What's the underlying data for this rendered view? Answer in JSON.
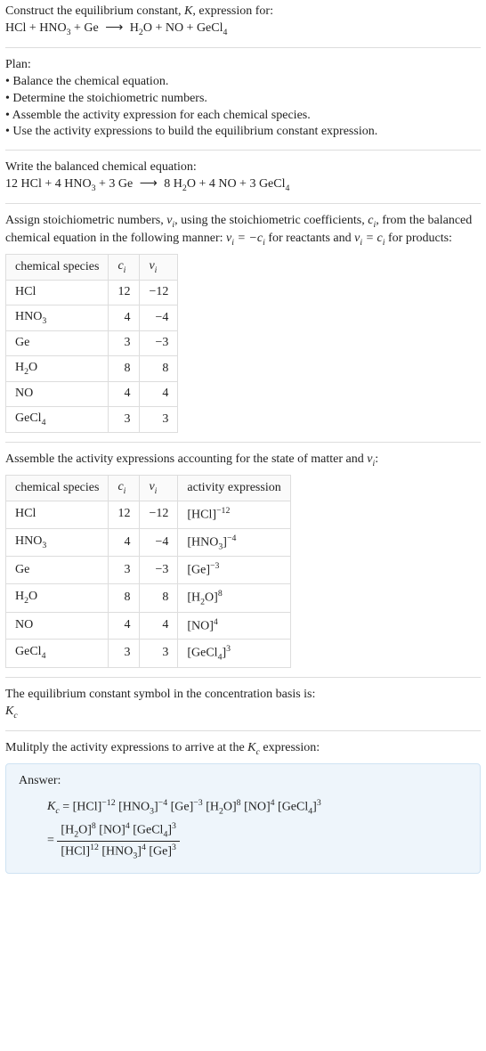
{
  "intro": {
    "line1_a": "Construct the equilibrium constant, ",
    "K": "K",
    "line1_b": ", expression for:",
    "eq_unbalanced_lhs": "HCl + HNO",
    "eq_unbalanced_rhs": " + Ge ",
    "arrow": "⟶",
    "eq_unbalanced_prod": " H₂O + NO + GeCl₄"
  },
  "plan": {
    "header": "Plan:",
    "b1": "• Balance the chemical equation.",
    "b2": "• Determine the stoichiometric numbers.",
    "b3": "• Assemble the activity expression for each chemical species.",
    "b4": "• Use the activity expressions to build the equilibrium constant expression."
  },
  "balanced": {
    "header": "Write the balanced chemical equation:",
    "eq": "12 HCl + 4 HNO₃ + 3 Ge ⟶ 8 H₂O + 4 NO + 3 GeCl₄"
  },
  "stoich_text": {
    "a": "Assign stoichiometric numbers, ",
    "nu": "ν",
    "i": "i",
    "b": ", using the stoichiometric coefficients, ",
    "c": "c",
    "d": ", from the balanced chemical equation in the following manner: ",
    "rel1": "νᵢ = −cᵢ",
    "e": " for reactants and ",
    "rel2": "νᵢ = cᵢ",
    "f": " for products:"
  },
  "table1": {
    "h1": "chemical species",
    "h2": "cᵢ",
    "h3": "νᵢ",
    "rows": [
      {
        "sp": "HCl",
        "ci": "12",
        "vi": "−12"
      },
      {
        "sp": "HNO₃",
        "ci": "4",
        "vi": "−4"
      },
      {
        "sp": "Ge",
        "ci": "3",
        "vi": "−3"
      },
      {
        "sp": "H₂O",
        "ci": "8",
        "vi": "8"
      },
      {
        "sp": "NO",
        "ci": "4",
        "vi": "4"
      },
      {
        "sp": "GeCl₄",
        "ci": "3",
        "vi": "3"
      }
    ]
  },
  "activity_text": "Assemble the activity expressions accounting for the state of matter and νᵢ:",
  "table2": {
    "h1": "chemical species",
    "h2": "cᵢ",
    "h3": "νᵢ",
    "h4": "activity expression",
    "rows": [
      {
        "sp": "HCl",
        "ci": "12",
        "vi": "−12",
        "ae": "[HCl]⁻¹²"
      },
      {
        "sp": "HNO₃",
        "ci": "4",
        "vi": "−4",
        "ae": "[HNO₃]⁻⁴"
      },
      {
        "sp": "Ge",
        "ci": "3",
        "vi": "−3",
        "ae": "[Ge]⁻³"
      },
      {
        "sp": "H₂O",
        "ci": "8",
        "vi": "8",
        "ae": "[H₂O]⁸"
      },
      {
        "sp": "NO",
        "ci": "4",
        "vi": "4",
        "ae": "[NO]⁴"
      },
      {
        "sp": "GeCl₄",
        "ci": "3",
        "vi": "3",
        "ae": "[GeCl₄]³"
      }
    ]
  },
  "kc_text": {
    "line1": "The equilibrium constant symbol in the concentration basis is:",
    "Kc": "K",
    "c": "c"
  },
  "multiply_text": "Mulitply the activity expressions to arrive at the K_c expression:",
  "multiply_a": "Mulitply the activity expressions to arrive at the ",
  "multiply_b": " expression:",
  "answer": {
    "label": "Answer:",
    "eq1_lhs": "K",
    "eq1_sub": "c",
    "eq1_rhs": " = [HCl]⁻¹² [HNO₃]⁻⁴ [Ge]⁻³ [H₂O]⁸ [NO]⁴ [GeCl₄]³",
    "eq2_eq": "= ",
    "eq2_num": "[H₂O]⁸ [NO]⁴ [GeCl₄]³",
    "eq2_den": "[HCl]¹² [HNO₃]⁴ [Ge]³"
  },
  "chart_data": {
    "type": "table",
    "tables": [
      {
        "title": "Stoichiometric numbers",
        "columns": [
          "chemical species",
          "c_i",
          "ν_i"
        ],
        "rows": [
          [
            "HCl",
            12,
            -12
          ],
          [
            "HNO3",
            4,
            -4
          ],
          [
            "Ge",
            3,
            -3
          ],
          [
            "H2O",
            8,
            8
          ],
          [
            "NO",
            4,
            4
          ],
          [
            "GeCl4",
            3,
            3
          ]
        ]
      },
      {
        "title": "Activity expressions",
        "columns": [
          "chemical species",
          "c_i",
          "ν_i",
          "activity expression"
        ],
        "rows": [
          [
            "HCl",
            12,
            -12,
            "[HCl]^-12"
          ],
          [
            "HNO3",
            4,
            -4,
            "[HNO3]^-4"
          ],
          [
            "Ge",
            3,
            -3,
            "[Ge]^-3"
          ],
          [
            "H2O",
            8,
            8,
            "[H2O]^8"
          ],
          [
            "NO",
            4,
            4,
            "[NO]^4"
          ],
          [
            "GeCl4",
            3,
            3,
            "[GeCl4]^3"
          ]
        ]
      }
    ]
  }
}
